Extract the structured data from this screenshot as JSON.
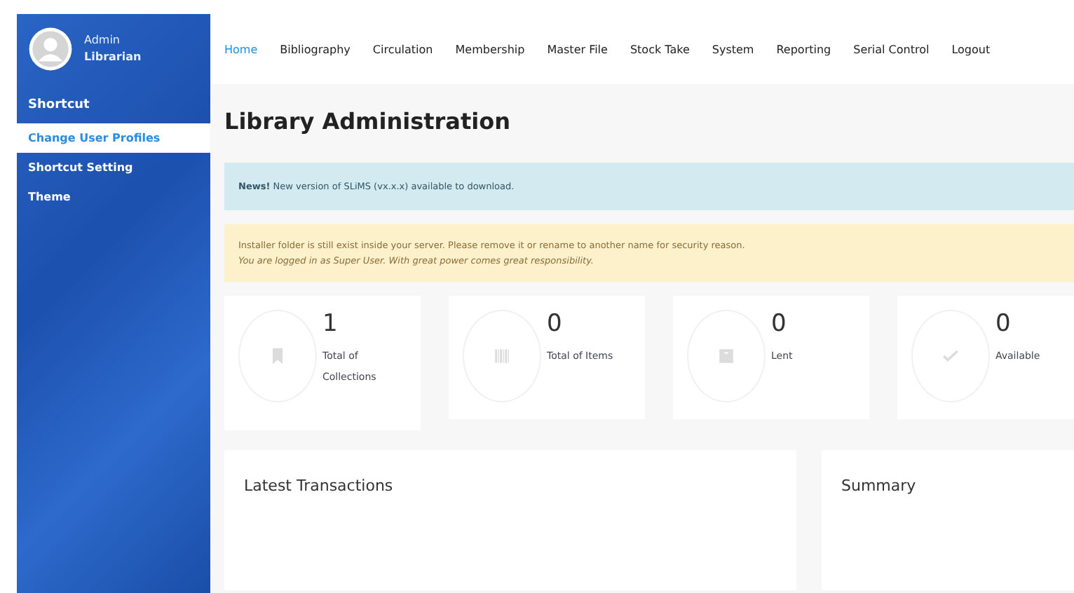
{
  "user": {
    "name": "Admin",
    "role": "Librarian"
  },
  "sidebar": {
    "heading": "Shortcut",
    "items": [
      {
        "label": "Change User Profiles",
        "selected": true
      },
      {
        "label": "Shortcut Setting",
        "selected": false
      },
      {
        "label": "Theme",
        "selected": false
      }
    ]
  },
  "nav": [
    {
      "label": "Home",
      "selected": true
    },
    {
      "label": "Bibliography",
      "selected": false
    },
    {
      "label": "Circulation",
      "selected": false
    },
    {
      "label": "Membership",
      "selected": false
    },
    {
      "label": "Master File",
      "selected": false
    },
    {
      "label": "Stock Take",
      "selected": false
    },
    {
      "label": "System",
      "selected": false
    },
    {
      "label": "Reporting",
      "selected": false
    },
    {
      "label": "Serial Control",
      "selected": false
    },
    {
      "label": "Logout",
      "selected": false
    }
  ],
  "page_title": "Library Administration",
  "alerts": [
    {
      "kind": "info",
      "lines": [
        "**News!** New version of SLiMS (vx.x.x) available to download."
      ]
    },
    {
      "kind": "warning",
      "lines": [
        "Installer folder is still exist inside your server. Please remove it or rename to another name for security reason.",
        "*You are logged in as Super User. With great power comes great responsibility.*"
      ]
    }
  ],
  "stats": [
    {
      "value": "1",
      "label": "Total of Collections"
    },
    {
      "value": "0",
      "label": "Total of Items"
    },
    {
      "value": "0",
      "label": "Lent"
    },
    {
      "value": "0",
      "label": "Available"
    }
  ],
  "panels": [
    {
      "title": "Latest Transactions"
    },
    {
      "title": "Summary"
    }
  ]
}
